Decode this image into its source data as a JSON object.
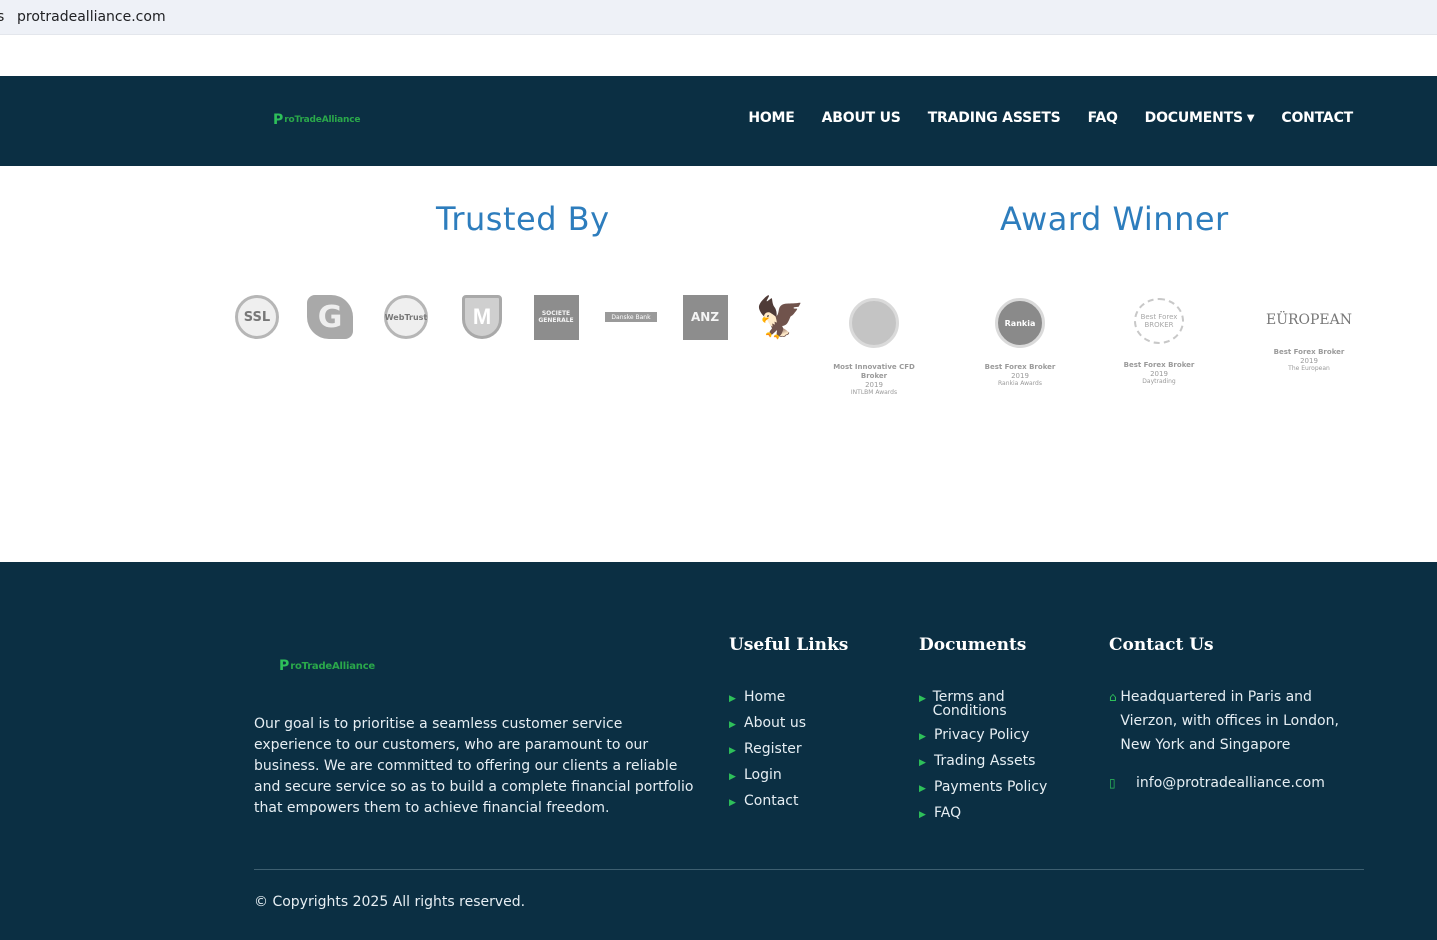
{
  "browser": {
    "left_fragment": "s",
    "url": "protradealliance.com"
  },
  "brand": {
    "mark": "P",
    "name": "roTradeAlliance"
  },
  "nav": {
    "items": [
      {
        "label": "HOME"
      },
      {
        "label": "ABOUT US"
      },
      {
        "label": "TRADING ASSETS"
      },
      {
        "label": "FAQ"
      },
      {
        "label": "DOCUMENTS",
        "has_dropdown": true
      },
      {
        "label": "CONTACT"
      }
    ],
    "caret": "⌄"
  },
  "trusted": {
    "title": "Trusted By",
    "logos": [
      {
        "name": "ssl-seal",
        "text": "SSL"
      },
      {
        "name": "g-logo",
        "text": "G"
      },
      {
        "name": "webtrust-seal",
        "text": "WebTrust"
      },
      {
        "name": "mcafee-shield",
        "text": "M"
      },
      {
        "name": "societe-generale",
        "text": "SOCIETE GENERALE"
      },
      {
        "name": "danske-bank",
        "text": "Danske Bank"
      },
      {
        "name": "anz",
        "text": "ANZ"
      },
      {
        "name": "barclays-eagle",
        "text": ""
      }
    ]
  },
  "awards": {
    "title": "Award Winner",
    "items": [
      {
        "emblem": "",
        "title": "Most Innovative CFD Broker",
        "year": "2019",
        "org": "INTLBM Awards"
      },
      {
        "emblem": "Rankia",
        "title": "Best Forex Broker",
        "year": "2019",
        "org": "Rankia Awards"
      },
      {
        "emblem": "Best Forex BROKER",
        "title": "Best Forex Broker",
        "year": "2019",
        "org": "Daytrading"
      },
      {
        "emblem": "EÜROPEAN",
        "title": "Best Forex Broker",
        "year": "2019",
        "org": "The European"
      }
    ]
  },
  "footer": {
    "about": "Our goal is to prioritise a seamless customer service experience to our customers, who are paramount to our business. We are committed to offering our clients a reliable and secure service so as to build a complete financial portfolio that empowers them to achieve financial freedom.",
    "useful_title": "Useful Links",
    "useful_links": [
      "Home",
      "About us",
      "Register",
      "Login",
      "Contact"
    ],
    "docs_title": "Documents",
    "doc_links": [
      "Terms and Conditions",
      "Privacy Policy",
      "Trading Assets",
      "Payments Policy",
      "FAQ"
    ],
    "contact_title": "Contact Us",
    "address": "Headquartered in Paris and Vierzon, with offices in London, New York and Singapore",
    "email": "info@protradealliance.com",
    "copyright": "© Copyrights 2025 All rights reserved."
  },
  "colors": {
    "navy": "#0b2f43",
    "accent_green": "#2ec05a",
    "heading_blue": "#2d7dbd"
  }
}
